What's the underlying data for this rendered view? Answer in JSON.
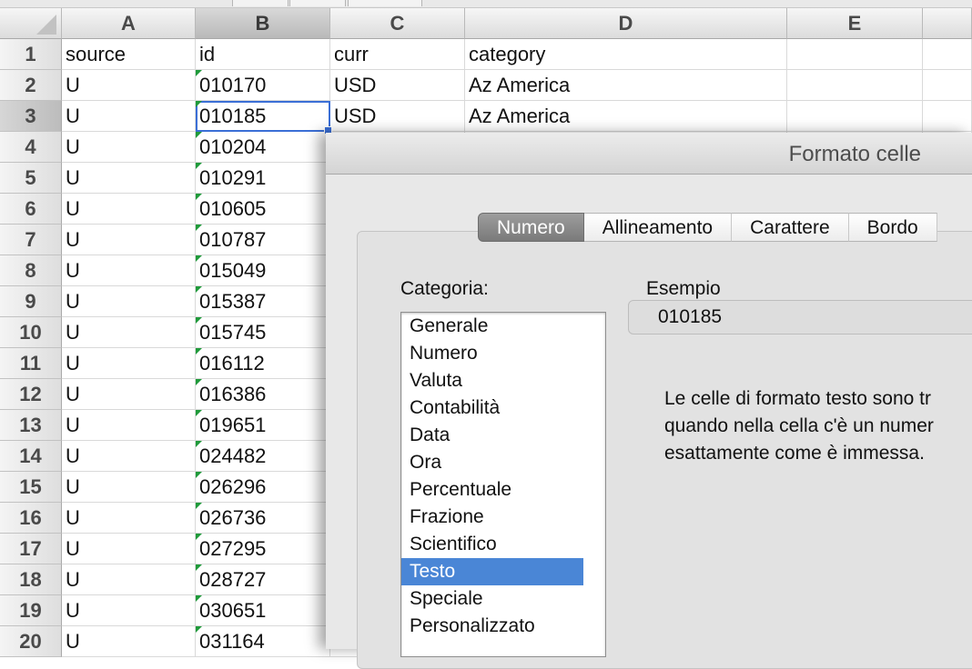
{
  "spreadsheet": {
    "columns": [
      "A",
      "B",
      "C",
      "D",
      "E"
    ],
    "selected_column": "B",
    "selected_row": "3",
    "rows": [
      {
        "num": "1",
        "a": "source",
        "b": "id",
        "c": "curr",
        "d": "category"
      },
      {
        "num": "2",
        "a": "U",
        "b": "010170",
        "c": "USD",
        "d": "Az America"
      },
      {
        "num": "3",
        "a": "U",
        "b": "010185",
        "c": "USD",
        "d": "Az America"
      },
      {
        "num": "4",
        "a": "U",
        "b": "010204"
      },
      {
        "num": "5",
        "a": "U",
        "b": "010291"
      },
      {
        "num": "6",
        "a": "U",
        "b": "010605"
      },
      {
        "num": "7",
        "a": "U",
        "b": "010787"
      },
      {
        "num": "8",
        "a": "U",
        "b": "015049"
      },
      {
        "num": "9",
        "a": "U",
        "b": "015387"
      },
      {
        "num": "10",
        "a": "U",
        "b": "015745"
      },
      {
        "num": "11",
        "a": "U",
        "b": "016112"
      },
      {
        "num": "12",
        "a": "U",
        "b": "016386"
      },
      {
        "num": "13",
        "a": "U",
        "b": "019651"
      },
      {
        "num": "14",
        "a": "U",
        "b": "024482"
      },
      {
        "num": "15",
        "a": "U",
        "b": "026296"
      },
      {
        "num": "16",
        "a": "U",
        "b": "026736"
      },
      {
        "num": "17",
        "a": "U",
        "b": "027295"
      },
      {
        "num": "18",
        "a": "U",
        "b": "028727"
      },
      {
        "num": "19",
        "a": "U",
        "b": "030651"
      },
      {
        "num": "20",
        "a": "U",
        "b": "031164"
      }
    ],
    "text_number_indicator_color": "#1f9a3a",
    "selection_color": "#3b6fd6"
  },
  "dialog": {
    "title": "Formato celle",
    "tabs": [
      {
        "label": "Numero",
        "active": true
      },
      {
        "label": "Allineamento",
        "active": false
      },
      {
        "label": "Carattere",
        "active": false
      },
      {
        "label": "Bordo",
        "active": false
      }
    ],
    "category_label": "Categoria:",
    "categories": [
      "Generale",
      "Numero",
      "Valuta",
      "Contabilità",
      "Data",
      "Ora",
      "Percentuale",
      "Frazione",
      "Scientifico",
      "Testo",
      "Speciale",
      "Personalizzato"
    ],
    "selected_category": "Testo",
    "example_label": "Esempio",
    "example_value": "010185",
    "description_lines": [
      "Le celle di formato testo sono tr",
      "quando nella cella c'è un numer",
      "esattamente come è immessa."
    ],
    "selection_color": "#4a86d6"
  }
}
